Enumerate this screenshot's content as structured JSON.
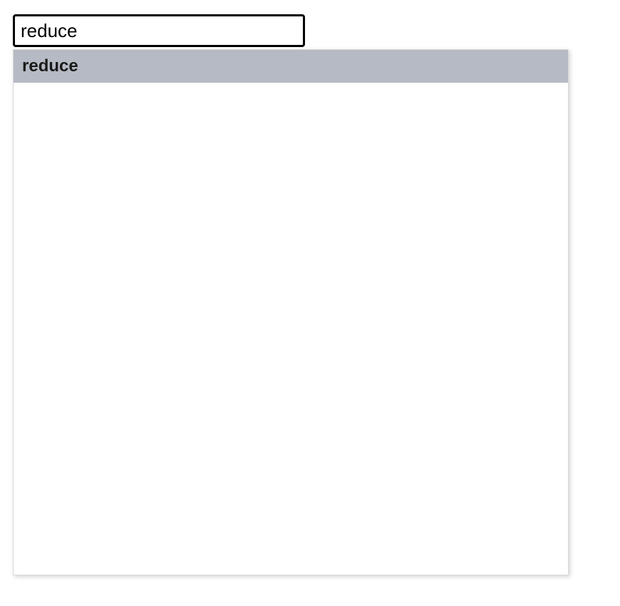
{
  "search": {
    "value": "reduce"
  },
  "suggestions": {
    "items": [
      {
        "label": "reduce"
      }
    ]
  }
}
